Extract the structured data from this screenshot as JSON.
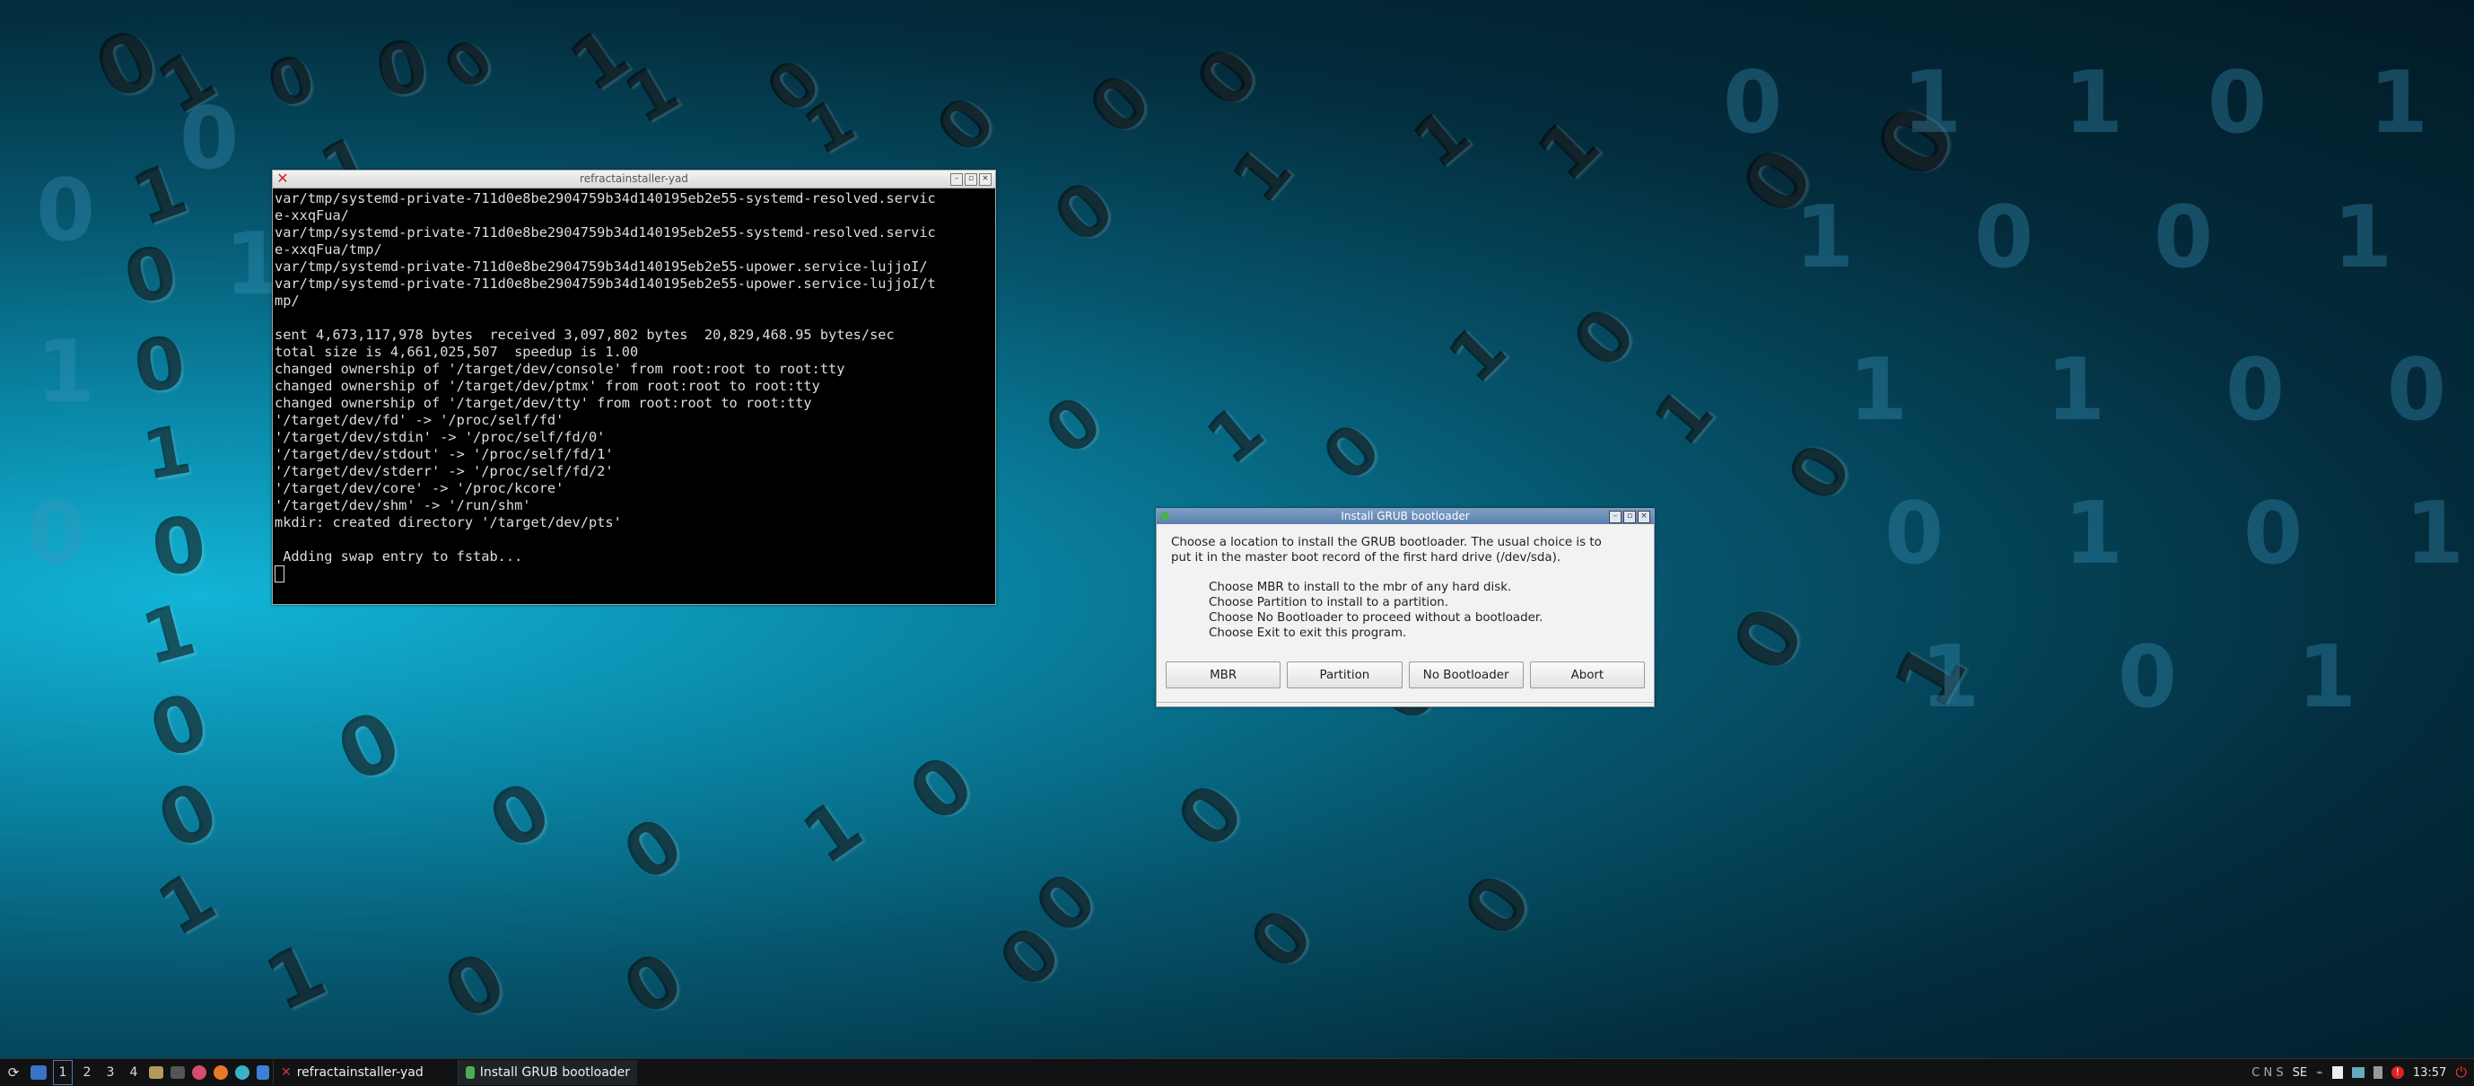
{
  "terminal": {
    "title": "refractainstaller-yad",
    "lines": [
      "var/tmp/systemd-private-711d0e8be2904759b34d140195eb2e55-systemd-resolved.servic",
      "e-xxqFua/",
      "var/tmp/systemd-private-711d0e8be2904759b34d140195eb2e55-systemd-resolved.servic",
      "e-xxqFua/tmp/",
      "var/tmp/systemd-private-711d0e8be2904759b34d140195eb2e55-upower.service-lujjoI/",
      "var/tmp/systemd-private-711d0e8be2904759b34d140195eb2e55-upower.service-lujjoI/t",
      "mp/",
      "",
      "sent 4,673,117,978 bytes  received 3,097,802 bytes  20,829,468.95 bytes/sec",
      "total size is 4,661,025,507  speedup is 1.00",
      "changed ownership of '/target/dev/console' from root:root to root:tty",
      "changed ownership of '/target/dev/ptmx' from root:root to root:tty",
      "changed ownership of '/target/dev/tty' from root:root to root:tty",
      "'/target/dev/fd' -> '/proc/self/fd'",
      "'/target/dev/stdin' -> '/proc/self/fd/0'",
      "'/target/dev/stdout' -> '/proc/self/fd/1'",
      "'/target/dev/stderr' -> '/proc/self/fd/2'",
      "'/target/dev/core' -> '/proc/kcore'",
      "'/target/dev/shm' -> '/run/shm'",
      "mkdir: created directory '/target/dev/pts'",
      "",
      " Adding swap entry to fstab..."
    ]
  },
  "dialog": {
    "title": "Install GRUB bootloader",
    "intro_line1": "Choose a location to install the GRUB bootloader. The usual choice is to",
    "intro_line2": "put it in the master boot record of the first hard drive (/dev/sda).",
    "options": [
      "Choose MBR to install to the mbr of any hard disk.",
      "Choose Partition to install to a partition.",
      "Choose No Bootloader to proceed without a bootloader.",
      "Choose Exit to exit this program."
    ],
    "buttons": {
      "mbr": "MBR",
      "partition": "Partition",
      "no_bootloader": "No Bootloader",
      "abort": "Abort"
    }
  },
  "taskbar": {
    "workspaces": [
      "1",
      "2",
      "3",
      "4"
    ],
    "tasks": [
      {
        "label": "refractainstaller-yad",
        "icon": "x-terminal-icon"
      },
      {
        "label": "Install GRUB bootloader",
        "icon": "installer-icon"
      }
    ],
    "keyboard_indicators": "C N S",
    "layout": "SE",
    "clock": "13:57"
  },
  "colors": {
    "dialog_title": "#5b7fae",
    "taskbar": "#101214",
    "terminal_bg": "#000000"
  }
}
